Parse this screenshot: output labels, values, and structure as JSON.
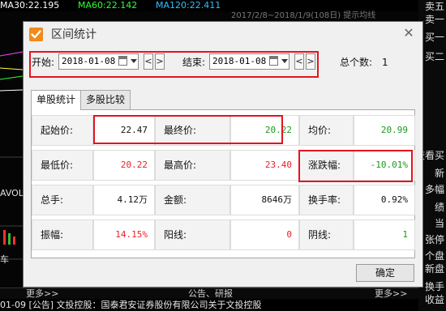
{
  "background": {
    "ma_line": [
      {
        "text": "MA30:22.195",
        "color": "#ffffff"
      },
      {
        "text": "MA60:22.142",
        "color": "#30ff30"
      },
      {
        "text": "MA120:22.411",
        "color": "#30c0ff"
      }
    ],
    "header_fragment": "2017/2/8~2018/1/9(108日) 提示均线",
    "right_labels": [
      "卖五",
      "卖一",
      "买一",
      "买二",
      "查看买",
      "新",
      "多幅",
      "绩",
      "当",
      "张停",
      "个盘",
      "新盘",
      "换手",
      "收益"
    ],
    "left_labels": [
      "AVOL",
      "车"
    ],
    "bottom_more_left": "更多>>",
    "bottom_center": "公告、研报",
    "bottom_more_right": "更多>>",
    "ticker": "01-09  [公告]  文投控股：国泰君安证券股份有限公司关于文投控股"
  },
  "dialog": {
    "title": "区间统计",
    "close_glyph": "✕",
    "start_label": "开始:",
    "start_date": "2018-01-08",
    "end_label": "结束:",
    "end_date": "2018-01-08",
    "prev_glyph": "<",
    "next_glyph": ">",
    "total_label": "总个数:",
    "total_value": "1",
    "tabs": [
      "单股统计",
      "多股比较"
    ],
    "stats": [
      [
        {
          "label": "起始价:",
          "value": "22.47",
          "color": "#111111"
        },
        {
          "label": "最终价:",
          "value": "20.22",
          "color": "#1a9a1a"
        },
        {
          "label": "均价:",
          "value": "20.99",
          "color": "#1a9a1a"
        }
      ],
      [
        {
          "label": "最低价:",
          "value": "20.22",
          "color": "#ee1c25"
        },
        {
          "label": "最高价:",
          "value": "23.40",
          "color": "#ee1c25"
        },
        {
          "label": "涨跌幅:",
          "value": "-10.01%",
          "color": "#1a9a1a"
        }
      ],
      [
        {
          "label": "总手:",
          "value": "4.12万",
          "color": "#111111"
        },
        {
          "label": "金额:",
          "value": "8646万",
          "color": "#111111"
        },
        {
          "label": "换手率:",
          "value": "0.92%",
          "color": "#111111"
        }
      ],
      [
        {
          "label": "振幅:",
          "value": "14.15%",
          "color": "#ee1c25"
        },
        {
          "label": "阳线:",
          "value": "0",
          "color": "#ee1c25"
        },
        {
          "label": "阴线:",
          "value": "1",
          "color": "#1a9a1a"
        }
      ]
    ],
    "ok_label": "确定"
  }
}
